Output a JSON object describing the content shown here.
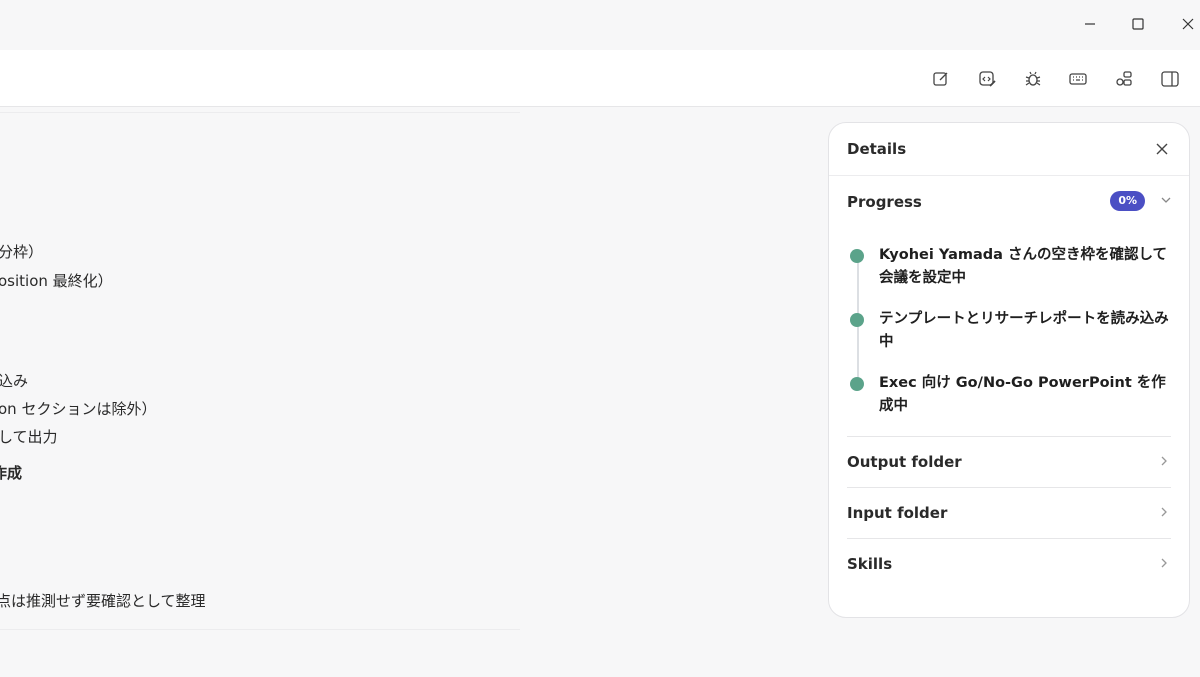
{
  "window": {
    "controls": [
      "minimize-icon",
      "maximize-icon",
      "close-icon"
    ]
  },
  "toolbar": {
    "icons": [
      "new-chat-icon",
      "code-review-icon",
      "debug-icon",
      "keyboard-icon",
      "connectors-icon",
      "side-panel-icon"
    ]
  },
  "main": {
    "fragments": [
      "分枠）",
      "osition 最終化）",
      "込み",
      "on セクションは除外）",
      "して出力",
      "作成",
      "点は推測せず要確認として整理"
    ]
  },
  "details": {
    "title": "Details",
    "progress_label": "Progress",
    "progress_badge": "0%",
    "progress_value": 0,
    "steps": [
      "Kyohei Yamada さんの空き枠を確認して会議を設定中",
      "テンプレートとリサーチレポートを読み込み中",
      "Exec 向け Go/No-Go PowerPoint を作成中"
    ],
    "rows": [
      "Output folder",
      "Input folder",
      "Skills"
    ]
  },
  "colors": {
    "badge": "#4b4fc4",
    "step_dot": "#5ba38a",
    "background": "#f7f7f8"
  }
}
